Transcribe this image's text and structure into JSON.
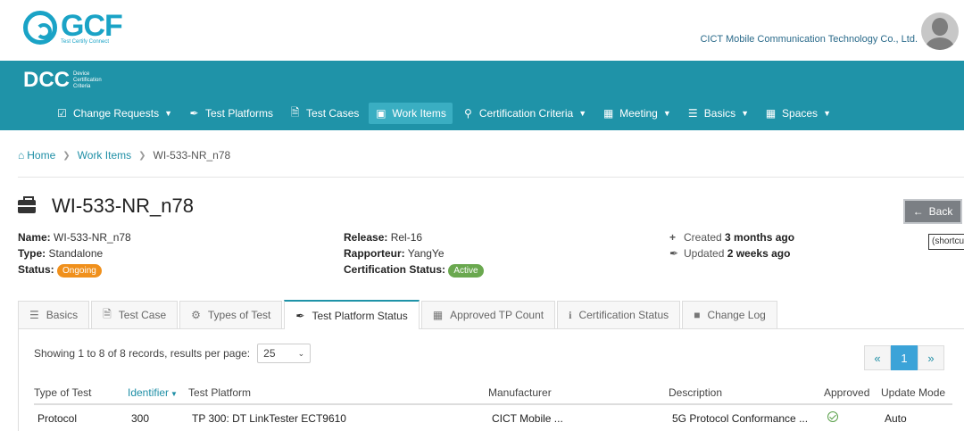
{
  "header": {
    "logo_text": "GCF",
    "logo_tagline": "Test Certify Connect",
    "company": "CICT Mobile Communication Technology Co., Ltd."
  },
  "dcc": {
    "logo": "DCC",
    "logo_sub_1": "Device",
    "logo_sub_2": "Certification",
    "logo_sub_3": "Criteria"
  },
  "nav": {
    "items": [
      {
        "label": "Change Requests",
        "icon": "clipboard-check-icon",
        "dropdown": true
      },
      {
        "label": "Test Platforms",
        "icon": "pen-icon",
        "dropdown": false
      },
      {
        "label": "Test Cases",
        "icon": "file-icon",
        "dropdown": false
      },
      {
        "label": "Work Items",
        "icon": "briefcase-icon",
        "dropdown": false,
        "active": true
      },
      {
        "label": "Certification Criteria",
        "icon": "award-icon",
        "dropdown": true
      },
      {
        "label": "Meeting",
        "icon": "calendar-icon",
        "dropdown": true
      },
      {
        "label": "Basics",
        "icon": "server-icon",
        "dropdown": true
      },
      {
        "label": "Spaces",
        "icon": "grid-icon",
        "dropdown": true
      }
    ]
  },
  "breadcrumb": {
    "home": "Home",
    "work_items": "Work Items",
    "current": "WI-533-NR_n78"
  },
  "page": {
    "title": "WI-533-NR_n78",
    "back_label": "Back",
    "shortcut_tip": "(shortcut"
  },
  "meta": {
    "name_label": "Name:",
    "name_value": "WI-533-NR_n78",
    "type_label": "Type:",
    "type_value": "Standalone",
    "status_label": "Status:",
    "status_value": "Ongoing",
    "release_label": "Release:",
    "release_value": "Rel-16",
    "rapporteur_label": "Rapporteur:",
    "rapporteur_value": "YangYe",
    "cert_status_label": "Certification Status:",
    "cert_status_value": "Active",
    "created_prefix": "Created",
    "created_value": "3 months ago",
    "updated_prefix": "Updated",
    "updated_value": "2 weeks ago"
  },
  "tabs": [
    {
      "label": "Basics",
      "icon": "list-icon"
    },
    {
      "label": "Test Case",
      "icon": "file-icon"
    },
    {
      "label": "Types of Test",
      "icon": "cogs-icon"
    },
    {
      "label": "Test Platform Status",
      "icon": "pen-icon",
      "active": true
    },
    {
      "label": "Approved TP Count",
      "icon": "calculator-icon"
    },
    {
      "label": "Certification Status",
      "icon": "info-icon"
    },
    {
      "label": "Change Log",
      "icon": "book-icon"
    }
  ],
  "table_controls": {
    "records_text": "Showing 1 to 8 of 8 records,  results per page:",
    "per_page": "25",
    "pager_prev": "«",
    "pager_page": "1",
    "pager_next": "»"
  },
  "table": {
    "columns": [
      "Type of Test",
      "Identifier",
      "Test Platform",
      "Manufacturer",
      "Description",
      "Approved",
      "Update Mode"
    ],
    "rows": [
      {
        "type": "Protocol",
        "identifier": "300",
        "platform": "TP 300: DT LinkTester ECT9610",
        "manufacturer": "CICT Mobile ...",
        "description": "5G Protocol Conformance ...",
        "approved": true,
        "update_mode": "Auto"
      }
    ]
  }
}
